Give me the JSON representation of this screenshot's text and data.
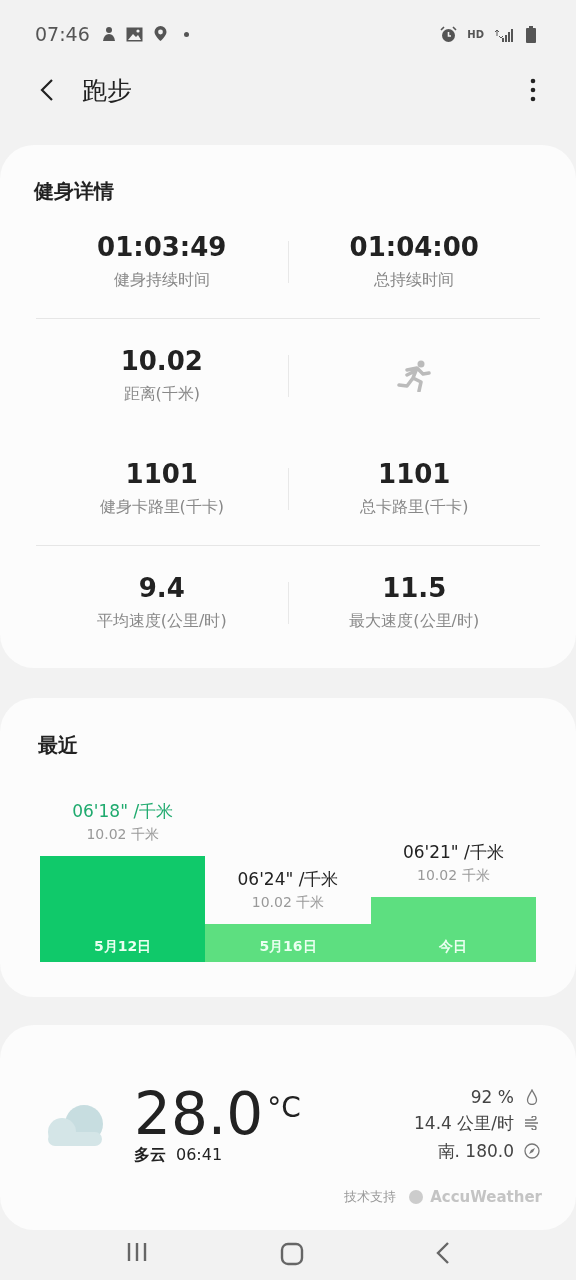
{
  "status_bar": {
    "time": "07:46",
    "network": "HD"
  },
  "header": {
    "title": "跑步"
  },
  "details": {
    "title": "健身详情",
    "rows": [
      {
        "cells": [
          {
            "kind": "stat",
            "value": "01:03:49",
            "label": "健身持续时间"
          },
          {
            "kind": "stat",
            "value": "01:04:00",
            "label": "总持续时间"
          }
        ]
      },
      {
        "cells": [
          {
            "kind": "stat",
            "value": "10.02",
            "label": "距离(千米)"
          },
          {
            "kind": "icon"
          }
        ]
      },
      {
        "cells": [
          {
            "kind": "stat",
            "value": "1101",
            "label": "健身卡路里(千卡)"
          },
          {
            "kind": "stat",
            "value": "1101",
            "label": "总卡路里(千卡)"
          }
        ]
      },
      {
        "cells": [
          {
            "kind": "stat",
            "value": "9.4",
            "label": "平均速度(公里/时)"
          },
          {
            "kind": "stat",
            "value": "11.5",
            "label": "最大速度(公里/时)"
          }
        ]
      }
    ]
  },
  "recent": {
    "title": "最近",
    "bars": [
      {
        "pace": "06'18\" /千米",
        "distance": "10.02 千米",
        "date": "5月12日",
        "selected": true
      },
      {
        "pace": "06'24\" /千米",
        "distance": "10.02 千米",
        "date": "5月16日",
        "selected": false
      },
      {
        "pace": "06'21\" /千米",
        "distance": "10.02 千米",
        "date": "今日",
        "selected": false
      }
    ]
  },
  "weather": {
    "temperature": "28.0",
    "unit": "°C",
    "condition": "多云",
    "time": "06:41",
    "humidity": "92 %",
    "wind_speed": "14.4 公里/时",
    "wind_direction": "南. 180.0",
    "credit": "技术支持",
    "provider": "AccuWeather"
  }
}
